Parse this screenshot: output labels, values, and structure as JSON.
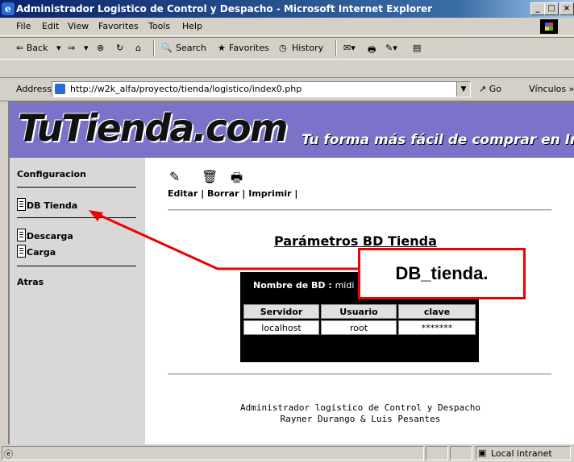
{
  "window": {
    "title": "Administrador Logistico de Control y Despacho - Microsoft Internet Explorer",
    "minimize": "_",
    "maximize": "□",
    "close": "×"
  },
  "menu": [
    "File",
    "Edit",
    "View",
    "Favorites",
    "Tools",
    "Help"
  ],
  "toolbar": {
    "back": "⇐ Back",
    "forward": "⇒",
    "stop": "⊗",
    "refresh": "↻",
    "home": "⌂",
    "search": "Search",
    "favorites": "Favorites",
    "history": "History"
  },
  "address": {
    "label": "Address",
    "url": "http://w2k_alfa/proyecto/tienda/logistico/index0.php",
    "go": "Go",
    "links": "Vínculos »"
  },
  "banner": {
    "logo": "TuTienda.com",
    "slogan": "Tu forma más fácil de comprar en Int"
  },
  "sidebar": {
    "configuracion": "Configuracion",
    "db_tienda": "DB Tienda",
    "descarga": "Descarga",
    "carga": "Carga",
    "atras": "Atras"
  },
  "actions": {
    "text": "Editar | Borrar | Imprimir |"
  },
  "page_title": "Parámetros BD Tienda",
  "db_panel": {
    "name_label": "Nombre de BD :",
    "name_value": "midi",
    "columns": [
      "Servidor",
      "Usuario",
      "clave"
    ],
    "row": [
      "localhost",
      "root",
      "*******"
    ]
  },
  "footer": {
    "line1": "Administrador logistico de Control y Despacho",
    "line2": "Rayner Durango & Luis Pesantes"
  },
  "status": {
    "zone": "Local intranet"
  },
  "annotation": {
    "text": "DB_tienda."
  }
}
